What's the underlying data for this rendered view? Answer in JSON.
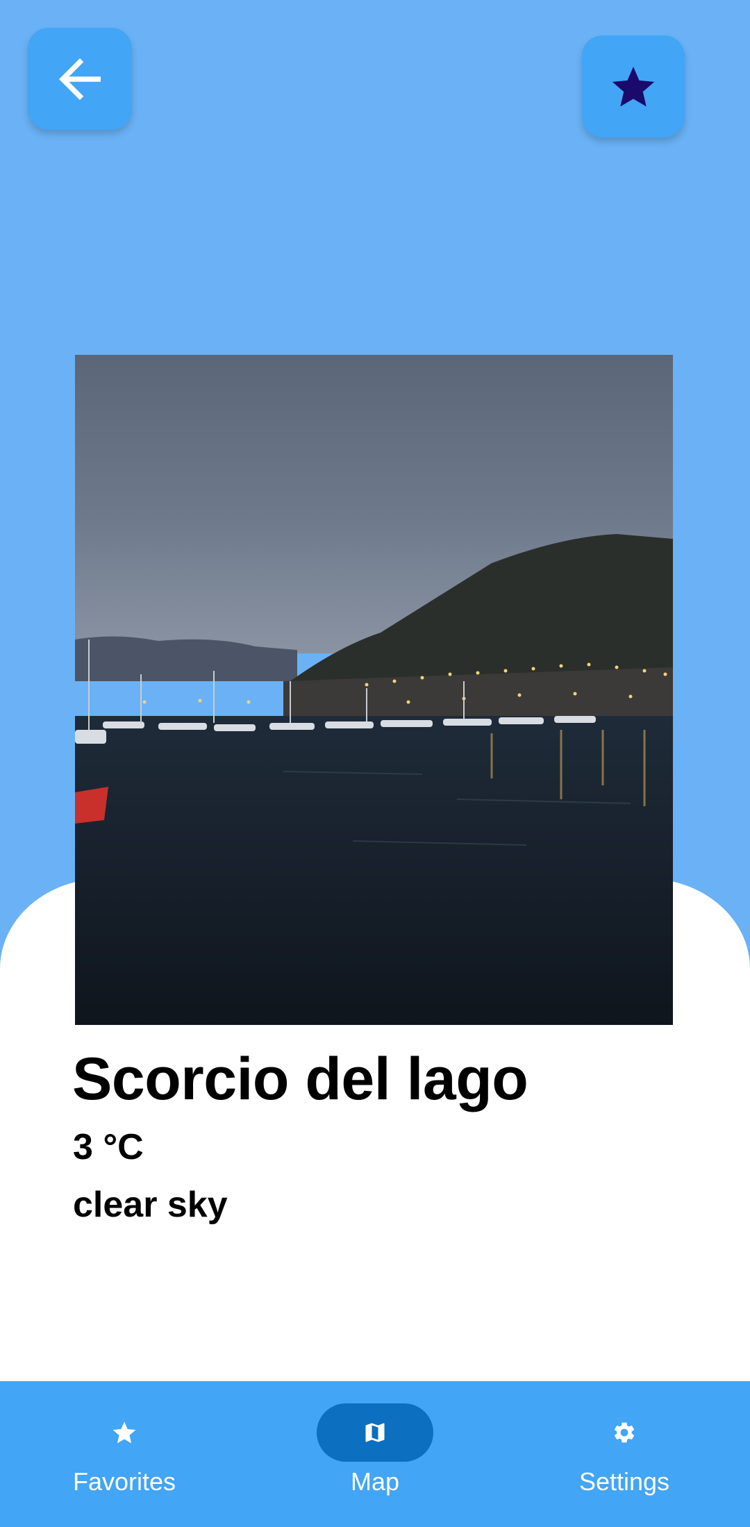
{
  "header": {
    "back_icon": "arrow-back-icon",
    "favorite_icon": "star-icon",
    "favorite_icon_color": "#1a0a6b"
  },
  "place": {
    "name": "Scorcio del lago",
    "temperature": "3 °C",
    "weather": "clear sky"
  },
  "nav": {
    "items": [
      {
        "label": "Favorites",
        "icon": "star-icon",
        "active": false
      },
      {
        "label": "Map",
        "icon": "map-icon",
        "active": true
      },
      {
        "label": "Settings",
        "icon": "gear-icon",
        "active": false
      }
    ]
  },
  "colors": {
    "background": "#6ab2f5",
    "accent": "#42a5f5",
    "active_pill": "#0d6fbf"
  }
}
